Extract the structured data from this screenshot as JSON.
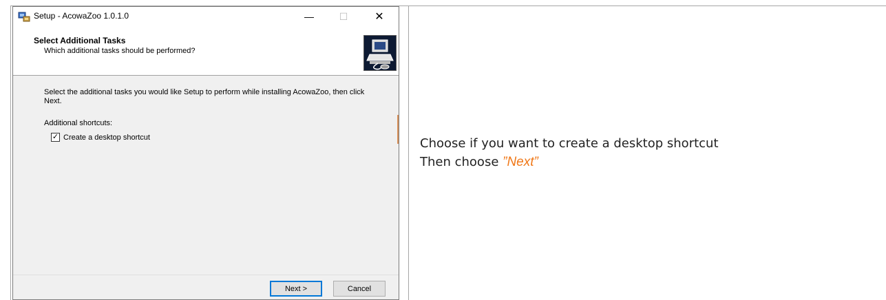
{
  "window": {
    "title": "Setup - AcowaZoo 1.0.1.0",
    "controls": {
      "minimize": "—",
      "maximize": "☐",
      "close": "✕"
    }
  },
  "header": {
    "title": "Select Additional Tasks",
    "subtitle": "Which additional tasks should be performed?",
    "image_icon": "computer-install-icon"
  },
  "body": {
    "description": "Select the additional tasks you would like Setup to perform while installing AcowaZoo, then click Next.",
    "group_label": "Additional shortcuts:",
    "tasks": [
      {
        "label": "Create a desktop shortcut",
        "checked": true
      }
    ]
  },
  "buttons": {
    "next": "Next >",
    "cancel": "Cancel"
  },
  "instructions": {
    "line1": "Choose if you want to create a desktop shortcut",
    "line2_prefix": "Then choose ",
    "line2_highlight": "”Next”"
  },
  "colors": {
    "accent": "#f07818",
    "focus": "#0078d7"
  }
}
